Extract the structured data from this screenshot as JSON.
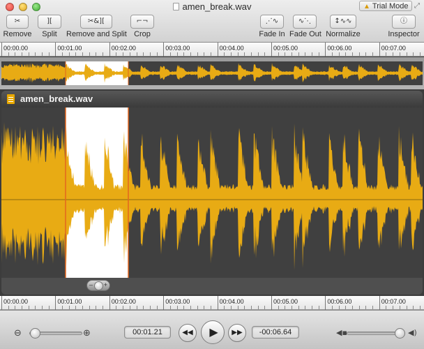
{
  "window": {
    "title": "amen_break.wav",
    "trial_badge": "Trial Mode"
  },
  "toolbar": {
    "remove": "Remove",
    "split": "Split",
    "remove_and_split": "Remove and Split",
    "crop": "Crop",
    "fade_in": "Fade In",
    "fade_out": "Fade Out",
    "normalize": "Normalize",
    "inspector": "Inspector"
  },
  "ruler": {
    "labels": [
      "00:00.00",
      "00:01.00",
      "00:02.00",
      "00:03.00",
      "00:04.00",
      "00:05.00",
      "00:06.00",
      "00:07.00"
    ]
  },
  "editor": {
    "file_name": "amen_break.wav"
  },
  "transport": {
    "current_time": "00:01.21",
    "remaining_time": "-00:06.64",
    "zoom_level": 0.1,
    "volume_level": 0.9
  },
  "colors": {
    "waveform": "#e8ab14",
    "waveform_selected": "#e8ab14",
    "selection_bg": "#ffffff",
    "editor_bg": "#404040",
    "selection_edge": "#e2661e"
  },
  "icons": [
    "scissors-icon",
    "split-icon",
    "remove-split-icon",
    "crop-icon",
    "fade-in-icon",
    "fade-out-icon",
    "normalize-icon",
    "info-icon",
    "zoom-out-icon",
    "zoom-in-icon",
    "rewind-icon",
    "play-icon",
    "fast-forward-icon",
    "volume-icon"
  ]
}
